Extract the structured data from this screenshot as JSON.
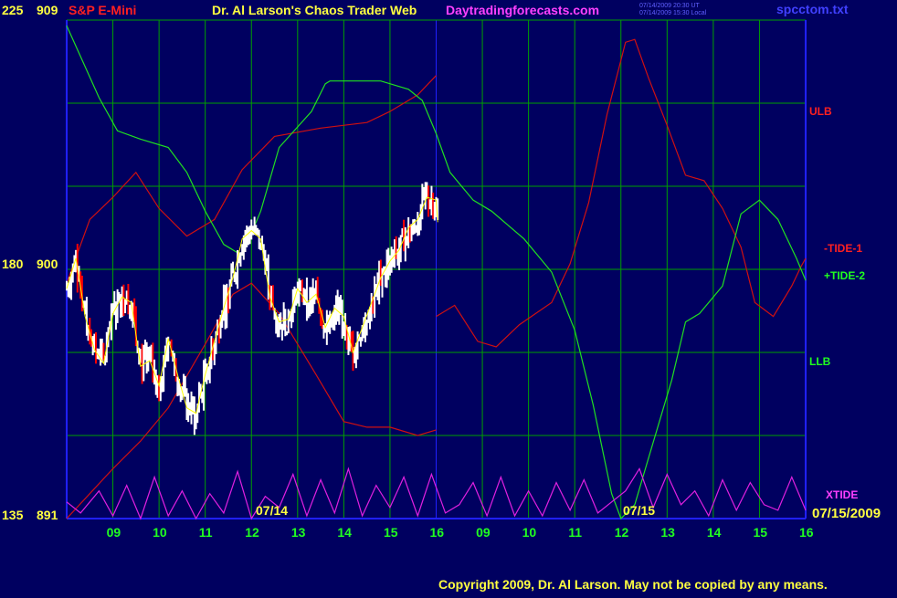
{
  "header": {
    "symbol": "S&P E-Mini",
    "title": "Dr. Al Larson's Chaos Trader Web",
    "site": "Daytradingforecasts.com",
    "timestamp_ut": "07/14/2009 20:30 UT",
    "timestamp_local": "07/14/2009 15:30 Local",
    "filename": "spcctom.txt"
  },
  "footer": {
    "copyright": "Copyright 2009, Dr. Al Larson. May not be copied by any means."
  },
  "colors": {
    "background": "#000060",
    "grid": "#00a000",
    "axis_blue": "#2020ff",
    "price_up": "#ffffff",
    "price_down": "#ff0000",
    "ma": "#ffff00",
    "band_red": "#d01010",
    "tide_green": "#20e020",
    "xtide": "#e020e0"
  },
  "chart_data": {
    "type": "line",
    "left_axis_labels": [
      {
        "idx": "225",
        "price": "909"
      },
      {
        "idx": "180",
        "price": "900"
      },
      {
        "idx": "135",
        "price": "891"
      }
    ],
    "ylim": [
      891,
      909
    ],
    "x_tick_labels": [
      "09",
      "10",
      "11",
      "12",
      "13",
      "14",
      "15",
      "16",
      "09",
      "10",
      "11",
      "12",
      "13",
      "14",
      "15",
      "16"
    ],
    "date_labels": [
      "07/14",
      "07/15",
      "07/15/2009"
    ],
    "right_labels": {
      "ulb": "ULB",
      "tide1": "-TIDE-1",
      "tide2": "+TIDE-2",
      "llb": "LLB",
      "xtide": "XTIDE"
    },
    "x_hours": [
      8,
      24
    ],
    "now_hour": 16,
    "series": [
      {
        "name": "ULB",
        "color": "#d01010",
        "points": [
          [
            8.0,
            899.5
          ],
          [
            8.5,
            901.8
          ],
          [
            9.0,
            902.6
          ],
          [
            9.5,
            903.5
          ],
          [
            10.0,
            902.2
          ],
          [
            10.6,
            901.2
          ],
          [
            11.2,
            901.8
          ],
          [
            11.8,
            903.6
          ],
          [
            12.5,
            904.8
          ],
          [
            13.5,
            905.1
          ],
          [
            14.5,
            905.3
          ],
          [
            15.0,
            905.7
          ],
          [
            15.6,
            906.3
          ],
          [
            16.0,
            907.0
          ]
        ]
      },
      {
        "name": "LLB",
        "color": "#d01010",
        "points": [
          [
            8.0,
            891.0
          ],
          [
            8.5,
            891.9
          ],
          [
            9.0,
            892.8
          ],
          [
            9.6,
            893.8
          ],
          [
            10.2,
            895.0
          ],
          [
            11.0,
            897.3
          ],
          [
            11.6,
            899.1
          ],
          [
            12.0,
            899.5
          ],
          [
            12.6,
            898.4
          ],
          [
            13.4,
            896.2
          ],
          [
            14.0,
            894.5
          ],
          [
            14.5,
            894.3
          ],
          [
            15.0,
            894.3
          ],
          [
            15.6,
            894.0
          ],
          [
            16.0,
            894.2
          ]
        ]
      },
      {
        "name": "-TIDE-1",
        "color": "#d01010",
        "points": [
          [
            16.0,
            898.3
          ],
          [
            16.4,
            898.7
          ],
          [
            16.9,
            897.4
          ],
          [
            17.3,
            897.2
          ],
          [
            17.8,
            898.0
          ],
          [
            18.5,
            898.8
          ],
          [
            18.9,
            900.2
          ],
          [
            19.3,
            902.4
          ],
          [
            19.7,
            905.6
          ],
          [
            20.1,
            908.2
          ],
          [
            20.3,
            908.3
          ],
          [
            20.6,
            906.9
          ],
          [
            21.0,
            905.2
          ],
          [
            21.4,
            903.4
          ],
          [
            21.8,
            903.2
          ],
          [
            22.2,
            902.2
          ],
          [
            22.6,
            900.8
          ],
          [
            22.9,
            898.8
          ],
          [
            23.3,
            898.3
          ],
          [
            23.7,
            899.4
          ],
          [
            23.9,
            900.1
          ],
          [
            24.0,
            900.4
          ]
        ]
      },
      {
        "name": "+TIDE-2",
        "color": "#20e020",
        "points": [
          [
            8.0,
            908.8
          ],
          [
            8.7,
            906.2
          ],
          [
            9.1,
            905.0
          ],
          [
            9.6,
            904.7
          ],
          [
            10.2,
            904.4
          ],
          [
            10.6,
            903.5
          ],
          [
            11.0,
            902.1
          ],
          [
            11.4,
            900.9
          ],
          [
            11.8,
            900.5
          ],
          [
            12.2,
            902.1
          ],
          [
            12.6,
            904.4
          ],
          [
            13.3,
            905.7
          ],
          [
            13.6,
            906.7
          ],
          [
            13.7,
            906.8
          ],
          [
            14.8,
            906.8
          ],
          [
            15.4,
            906.5
          ],
          [
            15.7,
            906.1
          ],
          [
            16.0,
            904.9
          ],
          [
            16.3,
            903.5
          ],
          [
            16.8,
            902.5
          ],
          [
            17.2,
            902.1
          ],
          [
            17.9,
            901.1
          ],
          [
            18.5,
            899.9
          ],
          [
            19.0,
            897.8
          ],
          [
            19.4,
            895.1
          ],
          [
            19.8,
            891.9
          ],
          [
            20.0,
            891.0
          ],
          [
            20.3,
            891.5
          ],
          [
            20.6,
            893.2
          ],
          [
            21.1,
            896.0
          ],
          [
            21.4,
            898.1
          ],
          [
            21.7,
            898.4
          ],
          [
            22.2,
            899.4
          ],
          [
            22.6,
            902.0
          ],
          [
            23.0,
            902.5
          ],
          [
            23.4,
            901.8
          ],
          [
            23.8,
            900.4
          ],
          [
            24.0,
            899.6
          ]
        ]
      },
      {
        "name": "Price",
        "color": "#ffffff",
        "points": [
          [
            8.0,
            899.3
          ],
          [
            8.2,
            900.4
          ],
          [
            8.4,
            898.3
          ],
          [
            8.6,
            897.1
          ],
          [
            8.8,
            896.6
          ],
          [
            9.0,
            898.4
          ],
          [
            9.2,
            899.0
          ],
          [
            9.4,
            898.8
          ],
          [
            9.6,
            896.5
          ],
          [
            9.8,
            896.7
          ],
          [
            10.0,
            895.8
          ],
          [
            10.2,
            897.5
          ],
          [
            10.4,
            896.2
          ],
          [
            10.6,
            895.0
          ],
          [
            10.8,
            894.8
          ],
          [
            11.0,
            896.2
          ],
          [
            11.2,
            897.4
          ],
          [
            11.4,
            898.6
          ],
          [
            11.6,
            899.7
          ],
          [
            11.8,
            901.1
          ],
          [
            12.0,
            901.4
          ],
          [
            12.2,
            901.1
          ],
          [
            12.4,
            899.0
          ],
          [
            12.6,
            898.1
          ],
          [
            12.8,
            898.2
          ],
          [
            13.0,
            899.3
          ],
          [
            13.2,
            898.8
          ],
          [
            13.4,
            899.1
          ],
          [
            13.6,
            897.9
          ],
          [
            13.8,
            898.6
          ],
          [
            14.0,
            898.3
          ],
          [
            14.2,
            897.0
          ],
          [
            14.4,
            897.9
          ],
          [
            14.6,
            898.8
          ],
          [
            14.8,
            899.7
          ],
          [
            15.0,
            900.3
          ],
          [
            15.2,
            900.7
          ],
          [
            15.4,
            901.5
          ],
          [
            15.6,
            901.8
          ],
          [
            15.8,
            902.6
          ],
          [
            16.0,
            902.5
          ],
          [
            16.05,
            901.3
          ]
        ]
      },
      {
        "name": "XTIDE",
        "color": "#e020e0",
        "points": [
          [
            8.0,
            891.6
          ],
          [
            8.3,
            891.2
          ],
          [
            8.7,
            892.0
          ],
          [
            9.0,
            891.1
          ],
          [
            9.3,
            892.2
          ],
          [
            9.6,
            891.0
          ],
          [
            9.9,
            892.5
          ],
          [
            10.2,
            891.1
          ],
          [
            10.5,
            892.0
          ],
          [
            10.8,
            891.0
          ],
          [
            11.1,
            891.9
          ],
          [
            11.4,
            891.2
          ],
          [
            11.7,
            892.7
          ],
          [
            12.0,
            891.0
          ],
          [
            12.3,
            891.8
          ],
          [
            12.6,
            891.4
          ],
          [
            12.9,
            892.6
          ],
          [
            13.2,
            891.1
          ],
          [
            13.5,
            892.4
          ],
          [
            13.8,
            891.2
          ],
          [
            14.1,
            892.8
          ],
          [
            14.4,
            891.1
          ],
          [
            14.7,
            892.2
          ],
          [
            15.0,
            891.4
          ],
          [
            15.3,
            892.5
          ],
          [
            15.6,
            891.1
          ],
          [
            15.9,
            892.6
          ],
          [
            16.2,
            891.2
          ],
          [
            16.5,
            891.5
          ],
          [
            16.8,
            892.3
          ],
          [
            17.1,
            891.1
          ],
          [
            17.4,
            892.5
          ],
          [
            17.7,
            891.1
          ],
          [
            18.0,
            892.0
          ],
          [
            18.3,
            891.1
          ],
          [
            18.6,
            892.3
          ],
          [
            18.9,
            891.3
          ],
          [
            19.2,
            892.4
          ],
          [
            19.5,
            891.2
          ],
          [
            19.8,
            891.6
          ],
          [
            20.1,
            892.0
          ],
          [
            20.4,
            892.8
          ],
          [
            20.7,
            891.4
          ],
          [
            21.0,
            892.6
          ],
          [
            21.3,
            891.5
          ],
          [
            21.6,
            892.0
          ],
          [
            21.9,
            891.1
          ],
          [
            22.2,
            892.4
          ],
          [
            22.5,
            891.3
          ],
          [
            22.8,
            892.3
          ],
          [
            23.1,
            891.5
          ],
          [
            23.4,
            891.3
          ],
          [
            23.7,
            892.5
          ],
          [
            24.0,
            891.3
          ]
        ]
      }
    ]
  }
}
